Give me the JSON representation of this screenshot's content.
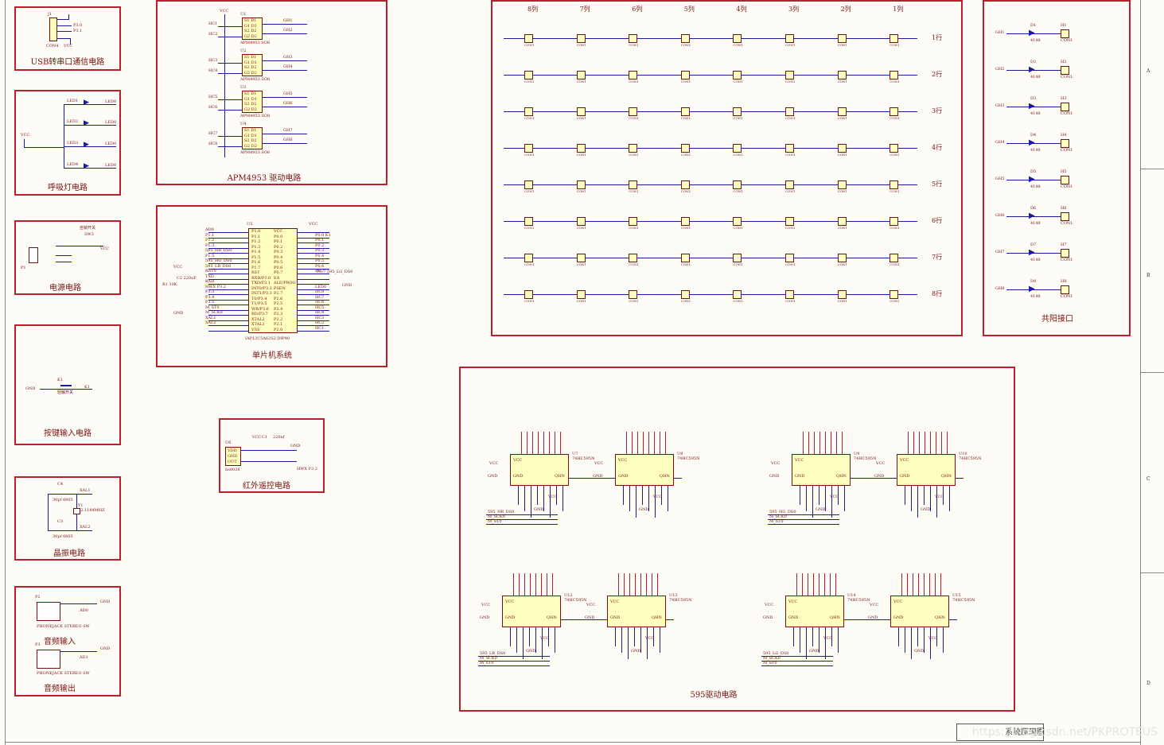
{
  "blocks": {
    "usb": {
      "title": "USB转串口通信电路",
      "part": "CON4",
      "vcc": "VCC",
      "ref": "J1",
      "nets": [
        "P3.0",
        "P3.1"
      ]
    },
    "breath": {
      "title": "呼吸灯电路",
      "vcc": "VCC",
      "leds": [
        "LED1",
        "LED2",
        "LED3",
        "LED4"
      ],
      "net": "LED0"
    },
    "power": {
      "title": "电源电路",
      "sw": "自锁开关",
      "sw_ref": "SW3",
      "vcc": "VCC",
      "ref": "P1"
    },
    "key": {
      "title": "按键输入电路",
      "gnd": "GND",
      "ref": "K1",
      "sub": "轻触开关",
      "net": "K1"
    },
    "crystal": {
      "title": "晶振电路",
      "c4": "C4",
      "c3": "C3",
      "cap": "30pf 0805",
      "y": "Y1",
      "freq": "22.1184MHZ",
      "xal1": "XAL1",
      "xal2": "XAL2"
    },
    "audio": {
      "in_title": "音频输入",
      "out_title": "音频输出",
      "jack": "PHONEJACK STEREO SW",
      "gnd": "GND",
      "p2": "P2",
      "p3": "P3",
      "ad": [
        "AD0",
        "AD1"
      ]
    },
    "apm": {
      "title": "APM4953 驱动电路",
      "part": "APM4953 SO8",
      "vcc": "VCC",
      "refs": [
        "U1",
        "U2",
        "U3",
        "U4"
      ],
      "hc": [
        "HC1",
        "HC2",
        "HC3",
        "HC4",
        "HC5",
        "HC6",
        "HC7",
        "HC8"
      ],
      "gh": [
        "GH1",
        "GH2",
        "GH3",
        "GH4",
        "GH5",
        "GH6",
        "GH7",
        "GH8"
      ],
      "pins": [
        "S1 D1",
        "G1 D1",
        "S2 D2",
        "G2 D2"
      ]
    },
    "mcu": {
      "title": "单片机系统",
      "part": "IAP12C5A62S2 DIP40",
      "ref": "U5",
      "vcc": "VCC",
      "gnd": "GND",
      "left": [
        "P1.0",
        "P1.1",
        "P1.2",
        "P1.3",
        "P1.4",
        "P1.5",
        "P1.6",
        "P1.7",
        "RST",
        "RXD/P3.0",
        "TXD/P3.1",
        "INT0/P3.2",
        "INT1/P3.3",
        "T0/P3.4",
        "T1/P3.5",
        "WR/P3.6",
        "RD/P3.7",
        "XTAL2",
        "XTAL1",
        "VSS"
      ],
      "right": [
        "VCC",
        "P0.0",
        "P0.1",
        "P0.2",
        "P0.3",
        "P0.4",
        "P0.5",
        "P0.6",
        "P0.7",
        "EA",
        "ALE/PROG",
        "PSEN",
        "P2.7",
        "P2.6",
        "P2.5",
        "P2.4",
        "P2.3",
        "P2.2",
        "P2.1",
        "P2.0"
      ],
      "left_nets": [
        "AD0",
        "P1.1",
        "P1.2",
        "P1.3",
        "595_HR_DS0",
        "P1.5",
        "595_HG_DS0",
        "595_LR_DS0",
        "RST0",
        "TXD",
        "RXD",
        "HWX P3.2",
        "P3.3",
        "P3.4",
        "P3.5",
        "M_ST0",
        "M_SCK0",
        "XAL1",
        "XAL2",
        ""
      ],
      "right_nets": [
        "",
        "P0.0 K1",
        "P0.1",
        "P0.2",
        "P0.3",
        "P0.4",
        "P0.5",
        "P0.6",
        "P0.7",
        "",
        "",
        "LED0",
        "HC8",
        "HC7",
        "HC6",
        "HC5",
        "HC4",
        "HC3",
        "HC2",
        "HC1"
      ],
      "r1": "R1 10K",
      "c2": "C2 220uF",
      "lg": "P0.7 595_LG_DS0"
    },
    "ir": {
      "title": "红外遥控电路",
      "part": "hs0038",
      "ref": "U6",
      "pins": [
        "VDD",
        "GND",
        "OUT"
      ],
      "vcc": "VCC",
      "c1": "C1",
      "cap": "220uf",
      "gnd": "GND",
      "net": "HWX P3.2"
    },
    "matrix": {
      "cols": [
        "8列",
        "7列",
        "6列",
        "5列",
        "4列",
        "3列",
        "2列",
        "1列"
      ],
      "rows": [
        "1行",
        "2行",
        "3行",
        "4行",
        "5行",
        "6行",
        "7行",
        "8行"
      ],
      "part": "CON1"
    },
    "anode": {
      "title": "共阳接口",
      "gh": [
        "GH1",
        "GH2",
        "GH3",
        "GH4",
        "GH5",
        "GH6",
        "GH7",
        "GH8"
      ],
      "diode": "4148",
      "part": "CON1",
      "d": [
        "D1",
        "D2",
        "D3",
        "D4",
        "D5",
        "D6",
        "D7",
        "D8"
      ],
      "h": [
        "H1",
        "H2",
        "H3",
        "H4",
        "H5",
        "H6",
        "H7",
        "H8"
      ]
    },
    "driver595": {
      "title": "595驱动电路",
      "part": "74HC595N",
      "refs": [
        "U7",
        "U8",
        "U9",
        "U10",
        "U12",
        "U13",
        "U14",
        "U15"
      ],
      "vcc": "VCC",
      "gnd": "GND",
      "qhn": "QHN",
      "nets_a": [
        "595_HR_DS0",
        "M_SCK0",
        "M_ST0"
      ],
      "nets_b": [
        "595_HG_DS0",
        "M_SCK0",
        "M_ST0"
      ],
      "nets_c": [
        "595_LR_DS0",
        "M_SCK0",
        "M_ST0"
      ],
      "nets_d": [
        "595_LG_DS0",
        "M_SCK0",
        "M_ST0"
      ]
    }
  },
  "zones": [
    "A",
    "B",
    "C",
    "D"
  ],
  "footer": {
    "watermark": "https://blog.csdn.net/PKPROTEUS",
    "corner": "系统原理图"
  },
  "colors": {
    "border": "#b8202c",
    "wire": "#1b1b9a",
    "text": "#7a1010",
    "chip": "#ffffc0"
  }
}
